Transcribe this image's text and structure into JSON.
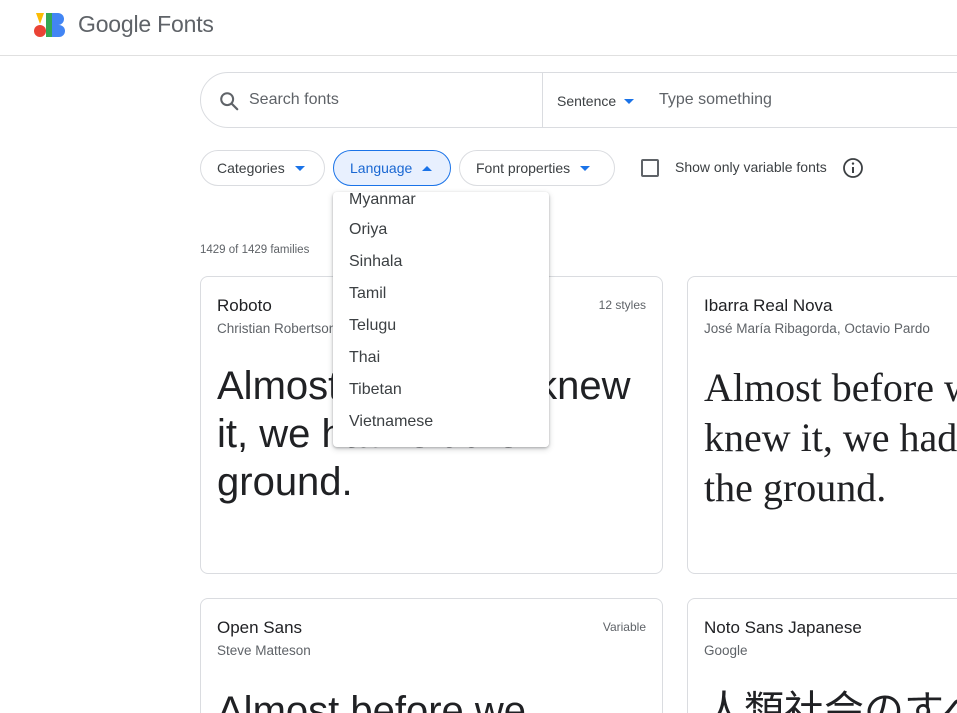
{
  "header": {
    "logo_text": "Google Fonts",
    "logo_colors": [
      "#EA4335",
      "#FBBC04",
      "#34A853",
      "#4285F4"
    ]
  },
  "search": {
    "placeholder": "Search fonts",
    "preview_mode": "Sentence",
    "preview_placeholder": "Type something"
  },
  "filters": {
    "categories": "Categories",
    "language": "Language",
    "font_properties": "Font properties",
    "variable_only": "Show only variable fonts",
    "variable_checked": false
  },
  "language_menu": {
    "items": [
      "Myanmar",
      "Oriya",
      "Sinhala",
      "Tamil",
      "Telugu",
      "Thai",
      "Tibetan",
      "Vietnamese"
    ]
  },
  "results": {
    "count": "1429 of 1429 families"
  },
  "cards": [
    {
      "name": "Roboto",
      "author": "Christian Robertson",
      "meta": "12 styles",
      "sample": "Almost before we knew it, we had left the ground."
    },
    {
      "name": "Ibarra Real Nova",
      "author": "José María Ribagorda, Octavio Pardo",
      "meta": "",
      "sample": "Almost before we knew it, we had left the ground."
    },
    {
      "name": "Open Sans",
      "author": "Steve Matteson",
      "meta": "Variable",
      "sample": "Almost before we"
    },
    {
      "name": "Noto Sans Japanese",
      "author": "Google",
      "meta": "",
      "sample": "人類社会のすべ"
    }
  ],
  "colors": {
    "accent": "#1a73e8",
    "active_chip_bg": "#e8f0fe",
    "border": "#dadce0",
    "text_secondary": "#5f6368"
  }
}
